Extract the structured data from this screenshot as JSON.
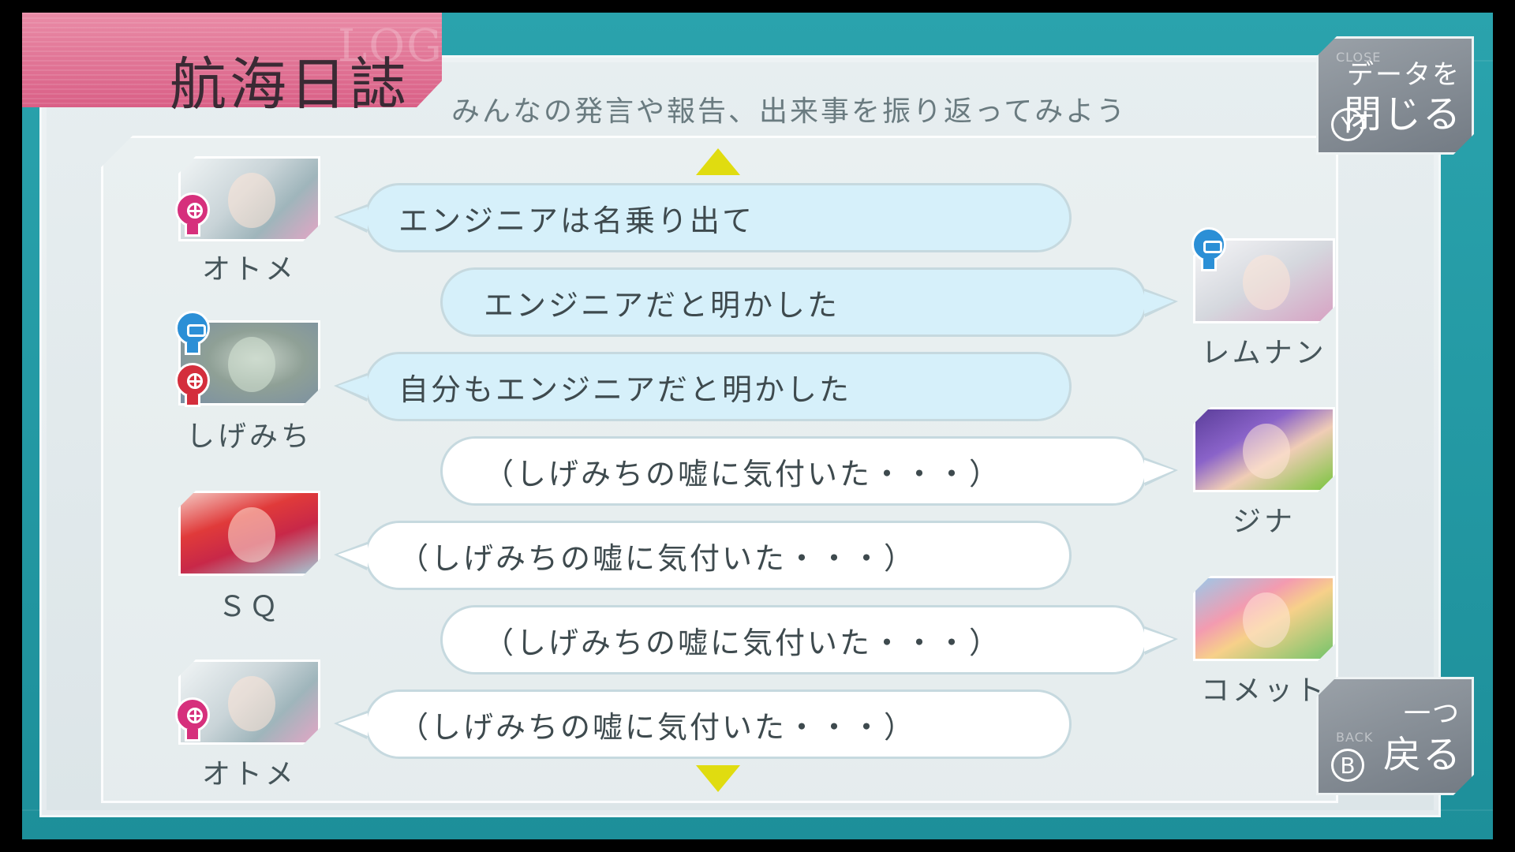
{
  "header": {
    "title": "航海日誌",
    "watermark": "LOG",
    "subtitle": "みんなの発言や報告、出来事を振り返ってみよう"
  },
  "controls": {
    "close": {
      "small": "CLOSE",
      "line1": "データを",
      "line2": "閉じる",
      "button": "Y"
    },
    "back": {
      "small": "BACK",
      "line1": "一つ",
      "line2": "戻る",
      "button": "B"
    }
  },
  "log": [
    {
      "speaker": "オトメ",
      "side": "left",
      "style": "blue",
      "text": "エンジニアは名乗り出て",
      "role": "pink"
    },
    {
      "speaker": "レムナン",
      "side": "right",
      "style": "blue",
      "text": "エンジニアだと明かした",
      "role": "blue"
    },
    {
      "speaker": "しげみち",
      "side": "left",
      "style": "blue",
      "text": "自分もエンジニアだと明かした",
      "role": "blue+red"
    },
    {
      "speaker": "ジナ",
      "side": "right",
      "style": "white",
      "text": "（しげみちの嘘に気付いた・・・）",
      "role": ""
    },
    {
      "speaker": "ＳＱ",
      "side": "left",
      "style": "white",
      "text": "（しげみちの嘘に気付いた・・・）",
      "role": ""
    },
    {
      "speaker": "コメット",
      "side": "right",
      "style": "white",
      "text": "（しげみちの嘘に気付いた・・・）",
      "role": ""
    },
    {
      "speaker": "オトメ",
      "side": "left",
      "style": "white",
      "text": "（しげみちの嘘に気付いた・・・）",
      "role": "pink"
    }
  ],
  "colors": {
    "frame": "#1d8f9a",
    "title_tab": "#d95f86",
    "bubble_blue": "#d6f0fa",
    "bubble_white": "#ffffff",
    "scroll_arrow": "#e0dc10"
  },
  "icons": {
    "scroll_up": "triangle-up",
    "scroll_down": "triangle-down",
    "role_badges": [
      "pink-crosshair-head",
      "red-crosshair-head",
      "blue-visor-head"
    ]
  }
}
